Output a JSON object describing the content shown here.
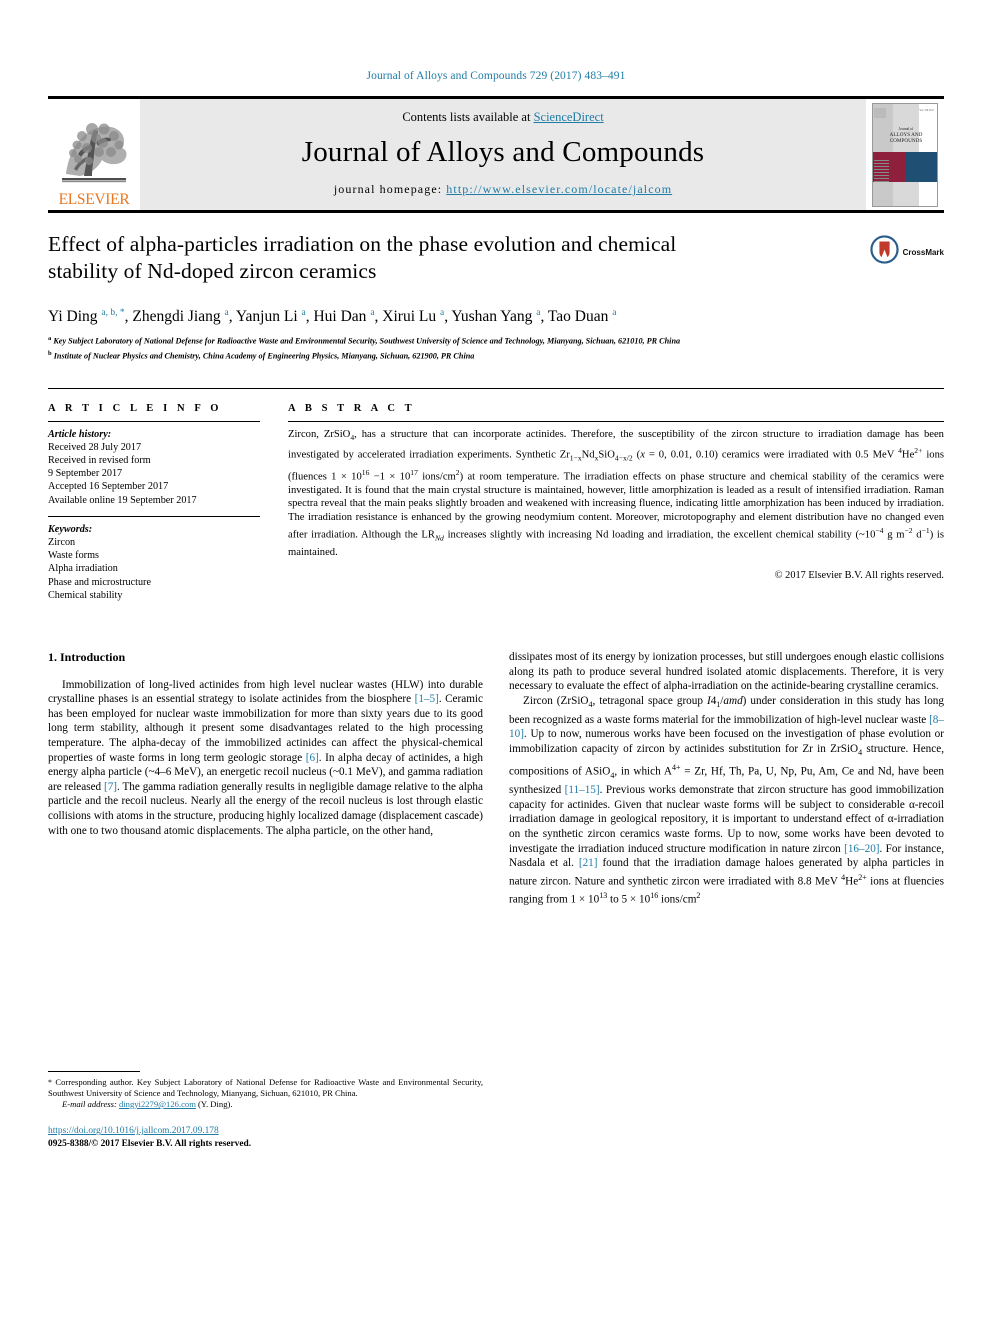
{
  "running_head": "Journal of Alloys and Compounds 729 (2017) 483–491",
  "masthead": {
    "publisher": "ELSEVIER",
    "contents_prefix": "Contents lists available at ",
    "sciencedirect": "ScienceDirect",
    "journal_title": "Journal of Alloys and Compounds",
    "homepage_label": "journal homepage: ",
    "homepage_url": "http://www.elsevier.com/locate/jalcom",
    "cover": {
      "line1": "Journal of",
      "line2": "ALLOYS",
      "line3": "AND COMPOUNDS",
      "sub": "An Interdisciplinary Journal of Materials Science and Solid-state Chemistry and Physics",
      "corner_tag": "Vol. 729  2017"
    }
  },
  "article": {
    "title": "Effect of alpha-particles irradiation on the phase evolution and chemical stability of Nd-doped zircon ceramics",
    "crossmark_label": "CrossMark",
    "authors": [
      {
        "name": "Yi Ding",
        "marks": "a, b, *"
      },
      {
        "name": "Zhengdi Jiang",
        "marks": "a"
      },
      {
        "name": "Yanjun Li",
        "marks": "a"
      },
      {
        "name": "Hui Dan",
        "marks": "a"
      },
      {
        "name": "Xirui Lu",
        "marks": "a"
      },
      {
        "name": "Yushan Yang",
        "marks": "a"
      },
      {
        "name": "Tao Duan",
        "marks": "a"
      }
    ],
    "affiliations": [
      {
        "mark": "a",
        "text": "Key Subject Laboratory of National Defense for Radioactive Waste and Environmental Security, Southwest University of Science and Technology, Mianyang, Sichuan, 621010, PR China"
      },
      {
        "mark": "b",
        "text": "Institute of Nuclear Physics and Chemistry, China Academy of Engineering Physics, Mianyang, Sichuan, 621900, PR China"
      }
    ]
  },
  "article_info": {
    "heading": "A R T I C L E  I N F O",
    "history_label": "Article history:",
    "history": [
      "Received 28 July 2017",
      "Received in revised form",
      "9 September 2017",
      "Accepted 16 September 2017",
      "Available online 19 September 2017"
    ],
    "keywords_label": "Keywords:",
    "keywords": [
      "Zircon",
      "Waste forms",
      "Alpha irradiation",
      "Phase and microstructure",
      "Chemical stability"
    ]
  },
  "abstract": {
    "heading": "A B S T R A C T",
    "paragraph_html": "Zircon, ZrSiO<sub>4</sub>, has a structure that can incorporate actinides. Therefore, the susceptibility of the zircon structure to irradiation damage has been investigated by accelerated irradiation experiments. Synthetic Zr<sub>1&minus;x</sub>Nd<sub>x</sub>SiO<sub>4&minus;x/2</sub> (<i>x</i> = 0, 0.01, 0.10) ceramics were irradiated with 0.5 MeV <sup>4</sup>He<sup>2+</sup> ions (fluences 1 &times; 10<sup>16</sup> &minus;1 &times; 10<sup>17</sup> ions/cm<sup>2</sup>) at room temperature. The irradiation effects on phase structure and chemical stability of the ceramics were investigated. It is found that the main crystal structure is maintained, however, little amorphization is leaded as a result of intensified irradiation. Raman spectra reveal that the main peaks slightly broaden and weakened with increasing fluence, indicating little amorphization has been induced by irradiation. The irradiation resistance is enhanced by the growing neodymium content. Moreover, microtopography and element distribution have no changed even after irradiation. Although the LR<sub><i>Nd</i></sub> increases slightly with increasing Nd loading and irradiation, the excellent chemical stability (~10<sup>&minus;4</sup> g m<sup>&minus;2</sup> d<sup>&minus;1</sup>) is maintained.",
    "copyright": "© 2017 Elsevier B.V. All rights reserved."
  },
  "introduction": {
    "heading": "1.  Introduction",
    "left_paragraphs_html": [
      "Immobilization of long-lived actinides from high level nuclear wastes (HLW) into durable crystalline phases is an essential strategy to isolate actinides from the biosphere <span class=\"ref\">[1&ndash;5]</span>. Ceramic has been employed for nuclear waste immobilization for more than sixty years due to its good long term stability, although it present some disadvantages related to the high processing temperature. The alpha-decay of the immobilized actinides can affect the physical-chemical properties of waste forms in long term geologic storage <span class=\"ref\">[6]</span>. In alpha decay of actinides, a high energy alpha particle (~4&ndash;6 MeV), an energetic recoil nucleus (~0.1 MeV), and gamma radiation are released <span class=\"ref\">[7]</span>. The gamma radiation generally results in negligible damage relative to the alpha particle and the recoil nucleus. Nearly all the energy of the recoil nucleus is lost through elastic collisions with atoms in the structure, producing highly localized damage (displacement cascade) with one to two thousand atomic displacements. The alpha particle, on the other hand,"
    ],
    "right_paragraphs_html": [
      "dissipates most of its energy by ionization processes, but still undergoes enough elastic collisions along its path to produce several hundred isolated atomic displacements. Therefore, it is very necessary to evaluate the effect of alpha-irradiation on the actinide-bearing crystalline ceramics.",
      "Zircon (ZrSiO<sub>4</sub>, tetragonal space group <i>I</i>4<sub>1</sub>/<i>amd</i>) under consideration in this study has long been recognized as a waste forms material for the immobilization of high-level nuclear waste <span class=\"ref\">[8&ndash;10]</span>. Up to now, numerous works have been focused on the investigation of phase evolution or immobilization capacity of zircon by actinides substitution for Zr in ZrSiO<sub>4</sub> structure. Hence, compositions of ASiO<sub>4</sub>, in which A<sup>4+</sup> = Zr, Hf, Th, Pa, U, Np, Pu, Am, Ce and Nd, have been synthesized <span class=\"ref\">[11&ndash;15]</span>. Previous works demonstrate that zircon structure has good immobilization capacity for actinides. Given that nuclear waste forms will be subject to considerable &alpha;-recoil irradiation damage in geological repository, it is important to understand effect of &alpha;-irradiation on the synthetic zircon ceramics waste forms. Up to now, some works have been devoted to investigate the irradiation induced structure modification in nature zircon <span class=\"ref\">[16&ndash;20]</span>. For instance, Nasdala et al. <span class=\"ref\">[21]</span> found that the irradiation damage haloes generated by alpha particles in nature zircon. Nature and synthetic zircon were irradiated with 8.8 MeV <sup>4</sup>He<sup>2+</sup> ions at fluencies ranging from 1 &times; 10<sup>13</sup> to 5 &times; 10<sup>16</sup> ions/cm<sup>2</sup>"
    ]
  },
  "footnote": {
    "corresponding_html": "<span class=\"star\">*</span> Corresponding author. Key Subject Laboratory of National Defense for Radioactive Waste and Environmental Security, Southwest University of Science and Technology, Mianyang, Sichuan, 621010, PR China.",
    "email_label": "E-mail address:",
    "email": "dingyi2279@126.com",
    "email_suffix": "(Y. Ding).",
    "doi": "https://doi.org/10.1016/j.jallcom.2017.09.178",
    "issn_line": "0925-8388/© 2017 Elsevier B.V. All rights reserved."
  },
  "colors": {
    "link": "#1f7ca6",
    "elsevier_orange": "#E87722",
    "cover_red": "#8e1f3d",
    "cover_blue": "#1f4f73"
  }
}
